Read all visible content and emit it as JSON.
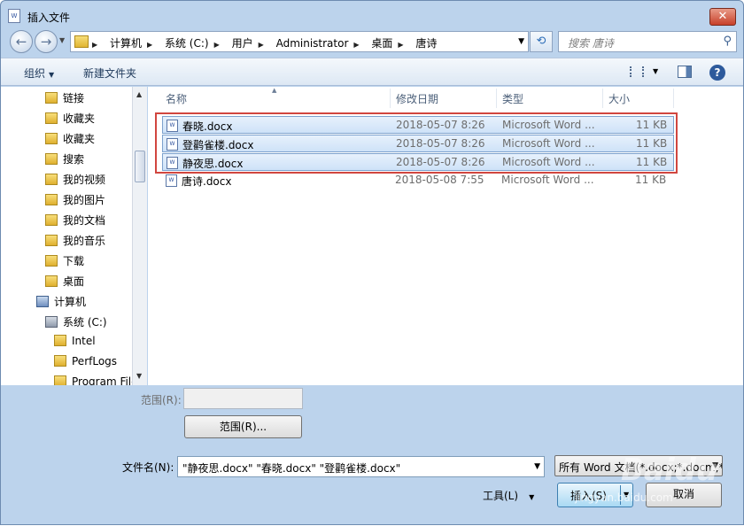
{
  "window": {
    "title": "插入文件",
    "close_label": "✕"
  },
  "nav": {
    "back_icon": "back-arrow-icon",
    "forward_icon": "forward-arrow-icon",
    "breadcrumbs": [
      "计算机",
      "系统 (C:)",
      "用户",
      "Administrator",
      "桌面",
      "唐诗"
    ],
    "search_placeholder": "搜索 唐诗"
  },
  "toolbar": {
    "organize_label": "组织",
    "new_folder_label": "新建文件夹"
  },
  "sidebar": {
    "items": [
      {
        "label": "链接",
        "icon": "folder-icon"
      },
      {
        "label": "收藏夹",
        "icon": "folder-icon"
      },
      {
        "label": "收藏夹",
        "icon": "folder-icon"
      },
      {
        "label": "搜索",
        "icon": "folder-icon"
      },
      {
        "label": "我的视频",
        "icon": "folder-icon"
      },
      {
        "label": "我的图片",
        "icon": "folder-icon"
      },
      {
        "label": "我的文档",
        "icon": "folder-icon"
      },
      {
        "label": "我的音乐",
        "icon": "folder-icon"
      },
      {
        "label": "下载",
        "icon": "folder-icon"
      },
      {
        "label": "桌面",
        "icon": "folder-icon"
      },
      {
        "label": "计算机",
        "icon": "computer-icon"
      },
      {
        "label": "系统 (C:)",
        "icon": "drive-icon"
      },
      {
        "label": "Intel",
        "icon": "folder-icon"
      },
      {
        "label": "PerfLogs",
        "icon": "folder-icon"
      },
      {
        "label": "Program Files",
        "icon": "folder-icon"
      }
    ]
  },
  "file_list": {
    "columns": [
      "名称",
      "修改日期",
      "类型",
      "大小"
    ],
    "rows": [
      {
        "name": "春晓.docx",
        "date": "2018-05-07  8:26",
        "type": "Microsoft Word ...",
        "size": "11 KB",
        "selected": true
      },
      {
        "name": "登鹳雀楼.docx",
        "date": "2018-05-07  8:26",
        "type": "Microsoft Word ...",
        "size": "11 KB",
        "selected": true
      },
      {
        "name": "静夜思.docx",
        "date": "2018-05-07  8:26",
        "type": "Microsoft Word ...",
        "size": "11 KB",
        "selected": true
      },
      {
        "name": "唐诗.docx",
        "date": "2018-05-08  7:55",
        "type": "Microsoft Word ...",
        "size": "11 KB",
        "selected": false
      }
    ]
  },
  "bottom": {
    "range_label": "范围(R):",
    "range_button": "范围(R)...",
    "filename_label": "文件名(N):",
    "filename_value": "\"静夜思.docx\" \"春晓.docx\" \"登鹳雀楼.docx\"",
    "filter_value": "所有 Word 文档(*.docx;*.docm;*.dotx)",
    "tools_label": "工具(L)",
    "insert_label": "插入(S)",
    "cancel_label": "取消"
  },
  "watermark": {
    "text": "Baidu",
    "sub": "jingyan.baidu.com"
  },
  "colors": {
    "selection_outline": "#d1463f",
    "accent": "#3c7fb1"
  }
}
